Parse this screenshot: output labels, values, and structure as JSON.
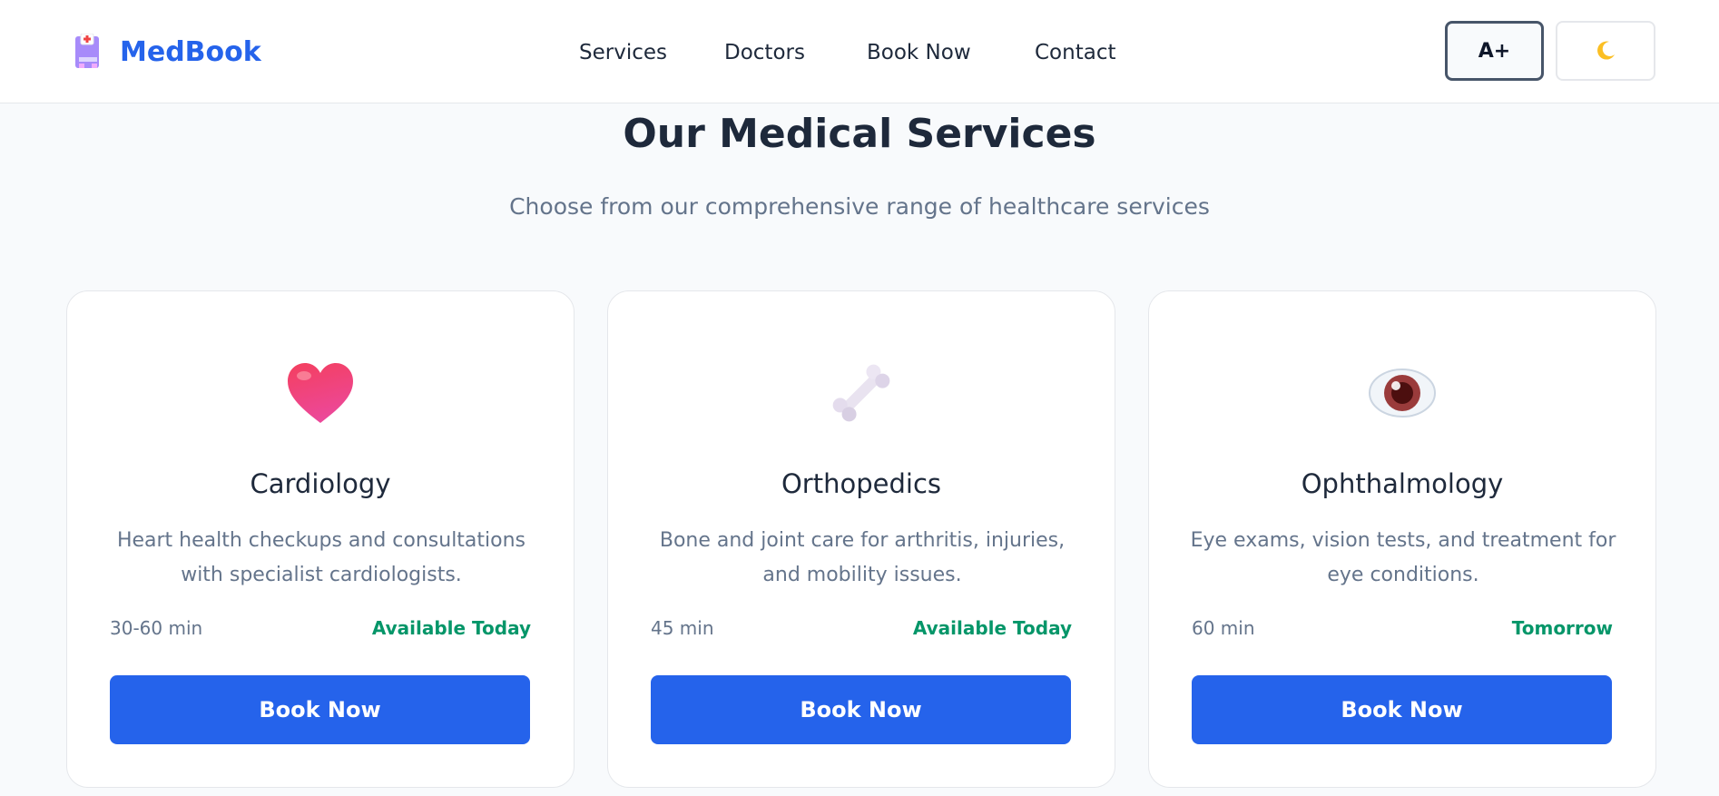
{
  "brand": {
    "name": "MedBook",
    "icon": "hospital-icon"
  },
  "nav": {
    "items": [
      {
        "label": "Services"
      },
      {
        "label": "Doctors"
      },
      {
        "label": "Book Now"
      },
      {
        "label": "Contact"
      }
    ]
  },
  "controls": {
    "font_size_label": "A+",
    "theme_icon": "moon-icon"
  },
  "section": {
    "title": "Our Medical Services",
    "subtitle": "Choose from our comprehensive range of healthcare services"
  },
  "services": [
    {
      "icon": "heart-icon",
      "title": "Cardiology",
      "description": "Heart health checkups and consultations with specialist cardiologists.",
      "duration": "30-60 min",
      "availability": "Available Today",
      "button": "Book Now"
    },
    {
      "icon": "bone-icon",
      "title": "Orthopedics",
      "description": "Bone and joint care for arthritis, injuries, and mobility issues.",
      "duration": "45 min",
      "availability": "Available Today",
      "button": "Book Now"
    },
    {
      "icon": "eye-icon",
      "title": "Ophthalmology",
      "description": "Eye exams, vision tests, and treatment for eye conditions.",
      "duration": "60 min",
      "availability": "Tomorrow",
      "button": "Book Now"
    }
  ],
  "colors": {
    "brand": "#2563eb",
    "available": "#059669",
    "background": "#f8fafc"
  }
}
